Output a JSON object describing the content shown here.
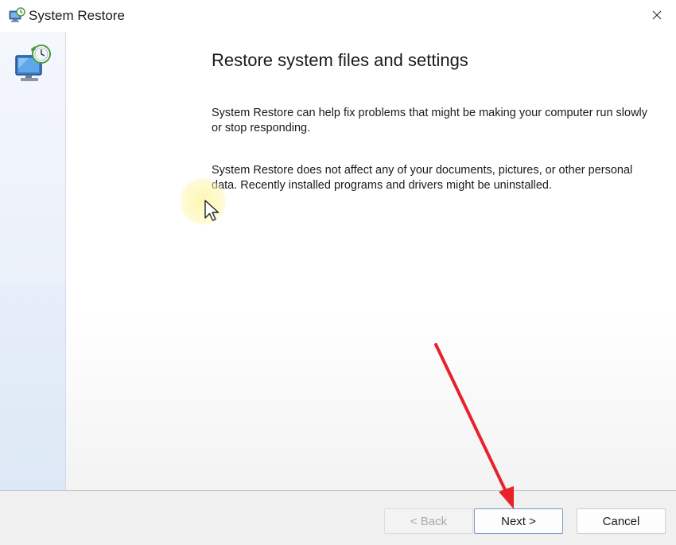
{
  "window": {
    "title": "System Restore",
    "close_label": "✕"
  },
  "main": {
    "heading": "Restore system files and settings",
    "paragraph1": "System Restore can help fix problems that might be making your computer run slowly or stop responding.",
    "paragraph2": "System Restore does not affect any of your documents, pictures, or other personal data. Recently installed programs and drivers might be uninstalled."
  },
  "footer": {
    "back_label": "< Back",
    "next_label": "Next >",
    "cancel_label": "Cancel"
  },
  "icons": {
    "title": "system-restore-icon",
    "sidebar": "computer-clock-icon"
  },
  "colors": {
    "arrow": "#e8212b",
    "highlight": "#fff6aa"
  }
}
